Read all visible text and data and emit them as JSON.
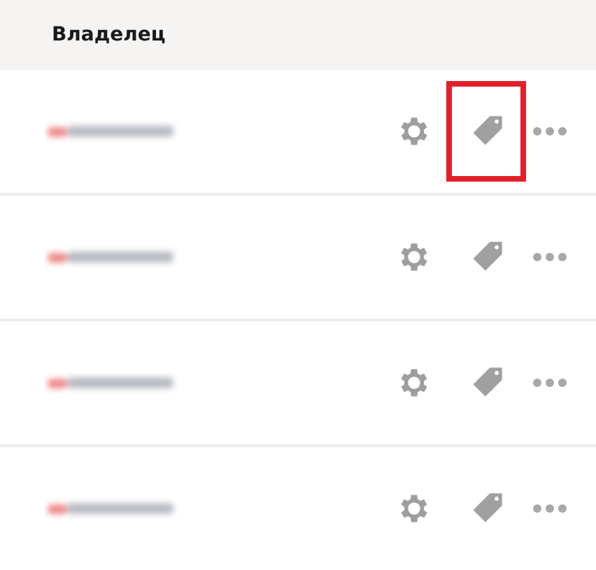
{
  "table": {
    "columns": [
      {
        "label": "Владелец"
      }
    ],
    "rows": [
      {
        "tag_highlighted": true
      },
      {
        "tag_highlighted": false
      },
      {
        "tag_highlighted": false
      },
      {
        "tag_highlighted": false
      }
    ]
  }
}
